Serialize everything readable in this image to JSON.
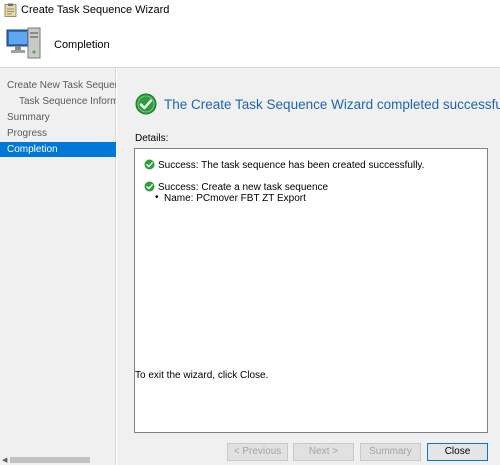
{
  "window": {
    "title": "Create Task Sequence Wizard"
  },
  "header": {
    "title": "Completion"
  },
  "sidebar": {
    "items": [
      {
        "label": "Create New Task Sequence"
      },
      {
        "label": "Task Sequence Informatio"
      },
      {
        "label": "Summary"
      },
      {
        "label": "Progress"
      },
      {
        "label": "Completion"
      }
    ],
    "selected": "Completion"
  },
  "main": {
    "headline": "The Create Task Sequence Wizard completed successfully",
    "details_label": "Details:",
    "details": {
      "line1": "Success: The task sequence has been created successfully.",
      "line2": "Success: Create a new task sequence",
      "bullet": "•",
      "line3": "Name: PCmover FBT ZT Export"
    },
    "exit_text": "To exit the wizard, click Close."
  },
  "buttons": {
    "previous": "< Previous",
    "next": "Next >",
    "summary": "Summary",
    "close": "Close"
  },
  "colors": {
    "accent": "#0078d7",
    "headline": "#1e64b4",
    "success_green": "#2e9e3c"
  },
  "icons": {
    "app": "task-sequence-wizard-icon",
    "header": "computer-icon",
    "success": "success-check-icon"
  }
}
